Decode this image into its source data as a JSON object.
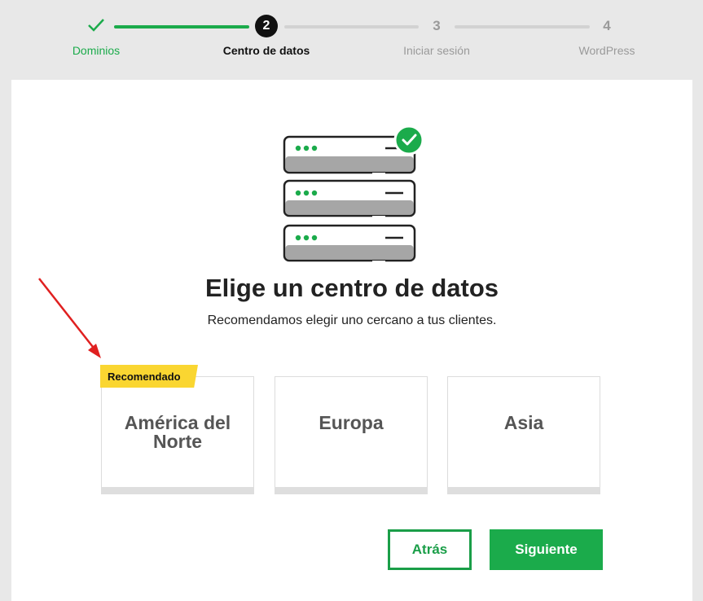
{
  "stepper": {
    "steps": [
      {
        "number": "",
        "label": "Dominios",
        "state": "done"
      },
      {
        "number": "2",
        "label": "Centro de datos",
        "state": "current"
      },
      {
        "number": "3",
        "label": "Iniciar sesión",
        "state": "future"
      },
      {
        "number": "4",
        "label": "WordPress",
        "state": "future"
      }
    ]
  },
  "main": {
    "title": "Elige un centro de datos",
    "subtitle": "Recomendamos elegir uno cercano a tus clientes.",
    "badge": "Recomendado",
    "options": [
      {
        "label": "América del Norte",
        "recommended": true
      },
      {
        "label": "Europa",
        "recommended": false
      },
      {
        "label": "Asia",
        "recommended": false
      }
    ]
  },
  "buttons": {
    "back": "Atrás",
    "next": "Siguiente"
  },
  "colors": {
    "accent": "#1bab4b",
    "badge": "#fad631",
    "annotation_arrow": "#e02020"
  }
}
